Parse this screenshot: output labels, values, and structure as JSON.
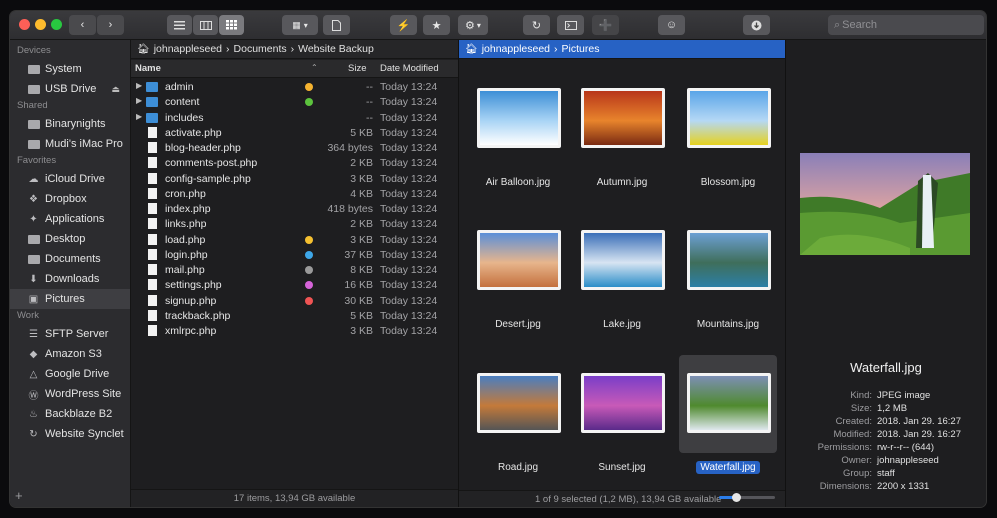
{
  "toolbar": {
    "search_placeholder": "Search",
    "colors": {
      "close": "#fe5f57",
      "minimize": "#febc2e",
      "zoom": "#28c840"
    }
  },
  "sidebar": {
    "sections": [
      {
        "title": "Devices",
        "items": [
          {
            "label": "System",
            "icon": "hard-drive-icon"
          },
          {
            "label": "USB Drive",
            "icon": "usb-drive-icon",
            "eject": true
          }
        ]
      },
      {
        "title": "Shared",
        "items": [
          {
            "label": "Binarynights",
            "icon": "network-computer-icon"
          },
          {
            "label": "Mudi's iMac Pro",
            "icon": "network-computer-icon"
          }
        ]
      },
      {
        "title": "Favorites",
        "items": [
          {
            "label": "iCloud Drive",
            "icon": "cloud-icon"
          },
          {
            "label": "Dropbox",
            "icon": "dropbox-icon"
          },
          {
            "label": "Applications",
            "icon": "applications-icon"
          },
          {
            "label": "Desktop",
            "icon": "desktop-icon"
          },
          {
            "label": "Documents",
            "icon": "documents-icon"
          },
          {
            "label": "Downloads",
            "icon": "downloads-icon"
          },
          {
            "label": "Pictures",
            "icon": "camera-icon",
            "selected": true
          }
        ]
      },
      {
        "title": "Work",
        "items": [
          {
            "label": "SFTP Server",
            "icon": "server-icon"
          },
          {
            "label": "Amazon S3",
            "icon": "amazon-s3-icon"
          },
          {
            "label": "Google Drive",
            "icon": "google-drive-icon"
          },
          {
            "label": "WordPress Site",
            "icon": "wordpress-icon"
          },
          {
            "label": "Backblaze B2",
            "icon": "backblaze-icon"
          },
          {
            "label": "Website Synclet",
            "icon": "sync-icon"
          }
        ]
      }
    ]
  },
  "left_pane": {
    "breadcrumb": [
      "johnappleseed",
      "Documents",
      "Website Backup"
    ],
    "columns": {
      "name": "Name",
      "size": "Size",
      "date": "Date Modified"
    },
    "files": [
      {
        "name": "admin",
        "type": "folder",
        "size": "--",
        "date": "Today 13:24",
        "tag": "#f5b330"
      },
      {
        "name": "content",
        "type": "folder",
        "size": "--",
        "date": "Today 13:24",
        "tag": "#5cc33d"
      },
      {
        "name": "includes",
        "type": "folder",
        "size": "--",
        "date": "Today 13:24",
        "tag": ""
      },
      {
        "name": "activate.php",
        "type": "file",
        "size": "5 KB",
        "date": "Today 13:24",
        "tag": ""
      },
      {
        "name": "blog-header.php",
        "type": "file",
        "size": "364 bytes",
        "date": "Today 13:24",
        "tag": ""
      },
      {
        "name": "comments-post.php",
        "type": "file",
        "size": "2 KB",
        "date": "Today 13:24",
        "tag": ""
      },
      {
        "name": "config-sample.php",
        "type": "file",
        "size": "3 KB",
        "date": "Today 13:24",
        "tag": ""
      },
      {
        "name": "cron.php",
        "type": "file",
        "size": "4 KB",
        "date": "Today 13:24",
        "tag": ""
      },
      {
        "name": "index.php",
        "type": "file",
        "size": "418 bytes",
        "date": "Today 13:24",
        "tag": ""
      },
      {
        "name": "links.php",
        "type": "file",
        "size": "2 KB",
        "date": "Today 13:24",
        "tag": ""
      },
      {
        "name": "load.php",
        "type": "file",
        "size": "3 KB",
        "date": "Today 13:24",
        "tag": "#f5c030"
      },
      {
        "name": "login.php",
        "type": "file",
        "size": "37 KB",
        "date": "Today 13:24",
        "tag": "#3ea7e8"
      },
      {
        "name": "mail.php",
        "type": "file",
        "size": "8 KB",
        "date": "Today 13:24",
        "tag": "#9a9a9a"
      },
      {
        "name": "settings.php",
        "type": "file",
        "size": "16 KB",
        "date": "Today 13:24",
        "tag": "#d563d8"
      },
      {
        "name": "signup.php",
        "type": "file",
        "size": "30 KB",
        "date": "Today 13:24",
        "tag": "#f05454"
      },
      {
        "name": "trackback.php",
        "type": "file",
        "size": "5 KB",
        "date": "Today 13:24",
        "tag": ""
      },
      {
        "name": "xmlrpc.php",
        "type": "file",
        "size": "3 KB",
        "date": "Today 13:24",
        "tag": ""
      }
    ],
    "status": "17 items, 13,94 GB available"
  },
  "right_pane": {
    "breadcrumb": [
      "johnappleseed",
      "Pictures"
    ],
    "thumbnails": [
      {
        "name": "Air Balloon.jpg",
        "colors": [
          "#3d8fd6",
          "#a9d4f5",
          "#ffffff"
        ]
      },
      {
        "name": "Autumn.jpg",
        "colors": [
          "#b8361a",
          "#e8842c",
          "#7a2a12"
        ]
      },
      {
        "name": "Blossom.jpg",
        "colors": [
          "#5aa5e8",
          "#b5d8f5",
          "#e6d21f"
        ]
      },
      {
        "name": "Desert.jpg",
        "colors": [
          "#5b8fd8",
          "#e7b58c",
          "#c4703d"
        ]
      },
      {
        "name": "Lake.jpg",
        "colors": [
          "#3a6fb8",
          "#d7e4f2",
          "#2a8dc8"
        ]
      },
      {
        "name": "Mountains.jpg",
        "colors": [
          "#6da0d4",
          "#3f6e5b",
          "#2c7fa6"
        ]
      },
      {
        "name": "Road.jpg",
        "colors": [
          "#4a7ec0",
          "#c47a3a",
          "#555555"
        ]
      },
      {
        "name": "Sunset.jpg",
        "colors": [
          "#7a3ec8",
          "#c85ab8",
          "#5a2a8a"
        ]
      },
      {
        "name": "Waterfall.jpg",
        "colors": [
          "#7d8fb5",
          "#4f8a2e",
          "#dfe8ee"
        ],
        "selected": true
      }
    ],
    "status": "1 of 9 selected (1,2 MB), 13,94 GB available",
    "zoom_fraction": 0.3
  },
  "preview": {
    "name": "Waterfall.jpg",
    "meta": [
      {
        "k": "Kind:",
        "v": "JPEG image"
      },
      {
        "k": "Size:",
        "v": "1,2 MB"
      },
      {
        "k": "Created:",
        "v": "2018. Jan 29. 16:27"
      },
      {
        "k": "Modified:",
        "v": "2018. Jan 29. 16:27"
      },
      {
        "k": "Permissions:",
        "v": "rw-r--r-- (644)"
      },
      {
        "k": "Owner:",
        "v": "johnappleseed"
      },
      {
        "k": "Group:",
        "v": "staff"
      },
      {
        "k": "Dimensions:",
        "v": "2200 x 1331"
      }
    ]
  }
}
